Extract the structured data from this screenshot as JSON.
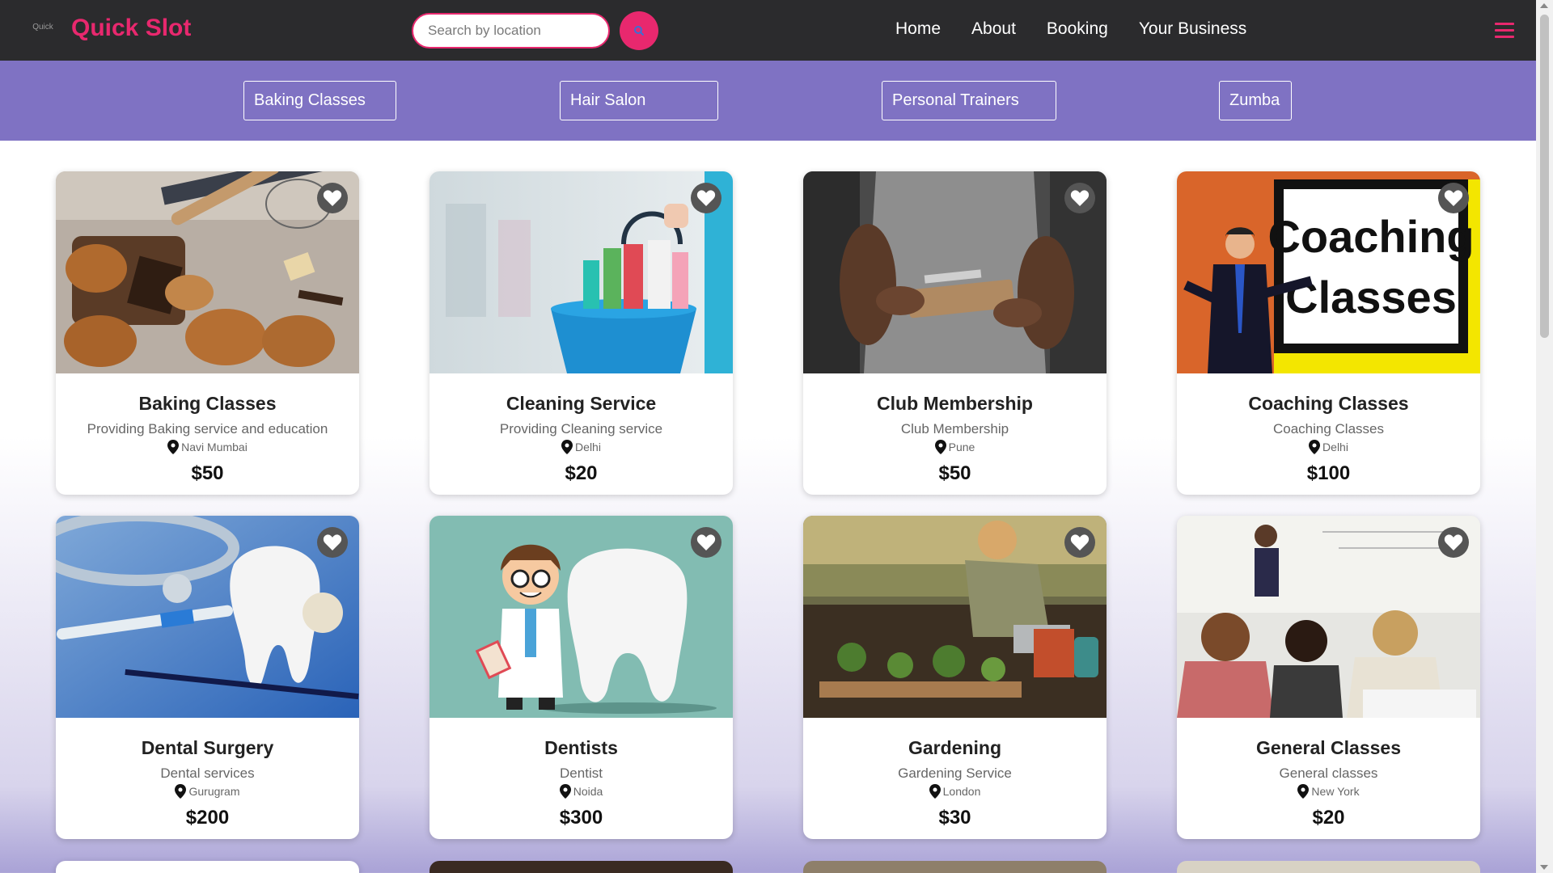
{
  "brand": {
    "logo_text": "Quick",
    "name": "Quick Slot"
  },
  "search": {
    "placeholder": "Search by location"
  },
  "nav": {
    "links": [
      "Home",
      "About",
      "Booking",
      "Your Business"
    ]
  },
  "categories": [
    "Baking Classes",
    "Hair Salon",
    "Personal Trainers",
    "Zumba"
  ],
  "colors": {
    "accent": "#e8286e",
    "navbar": "#2b2b2d",
    "category_bar": "#7f72c3"
  },
  "services": [
    {
      "title": "Baking Classes",
      "desc": "Providing Baking service and education",
      "location": "Navi Mumbai",
      "price": "$50",
      "image": "baking-pastries-image"
    },
    {
      "title": "Cleaning Service",
      "desc": "Providing Cleaning service",
      "location": "Delhi",
      "price": "$20",
      "image": "cleaning-bucket-image"
    },
    {
      "title": "Club Membership",
      "desc": "Club Membership",
      "location": "Pune",
      "price": "$50",
      "image": "trainer-clipboard-image"
    },
    {
      "title": "Coaching Classes",
      "desc": "Coaching Classes",
      "location": "Delhi",
      "price": "$100",
      "image": "coaching-board-image",
      "image_text": [
        "Coaching",
        "Classes"
      ]
    },
    {
      "title": "Dental Surgery",
      "desc": "Dental services",
      "location": "Gurugram",
      "price": "$200",
      "image": "dental-tools-image"
    },
    {
      "title": "Dentists",
      "desc": "Dentist",
      "location": "Noida",
      "price": "$300",
      "image": "cartoon-dentist-image"
    },
    {
      "title": "Gardening",
      "desc": "Gardening Service",
      "location": "London",
      "price": "$30",
      "image": "gardening-image"
    },
    {
      "title": "General Classes",
      "desc": "General classes",
      "location": "New York",
      "price": "$20",
      "image": "classroom-image"
    }
  ]
}
